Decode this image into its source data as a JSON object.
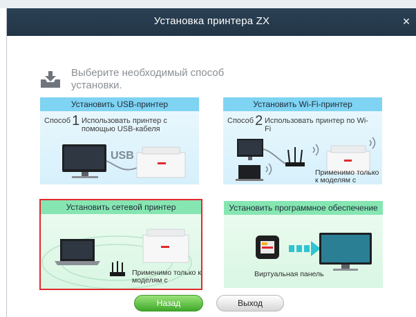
{
  "window": {
    "title": "Установка принтера ZX",
    "close_label": "×"
  },
  "heading": {
    "text": "Выберите необходимый способ установки."
  },
  "cards": {
    "usb": {
      "header": "Установить USB-принтер",
      "method_label": "Способ",
      "method_number": "1",
      "description": "Использовать принтер с помощью USB-кабеля",
      "usb_label": "USB"
    },
    "wifi": {
      "header": "Установить Wi-Fi-принтер",
      "method_label": "Способ",
      "method_number": "2",
      "description": "Использовать принтер по Wi-Fi",
      "note": "Применимо только к моделям с поддержкой Wi-Fi"
    },
    "network": {
      "header": "Установить сетевой принтер",
      "note": "Применимо только к моделям с",
      "selected": true
    },
    "software": {
      "header": "Установить программное обеспечение",
      "caption": "Виртуальная панель"
    }
  },
  "buttons": {
    "back": "Назад",
    "exit": "Выход"
  },
  "colors": {
    "titlebar": "#25394b",
    "card_blue_header": "#7fd3f3",
    "card_green_header": "#86e6b2",
    "selection": "#e0282e",
    "back_button": "#4fb534"
  }
}
